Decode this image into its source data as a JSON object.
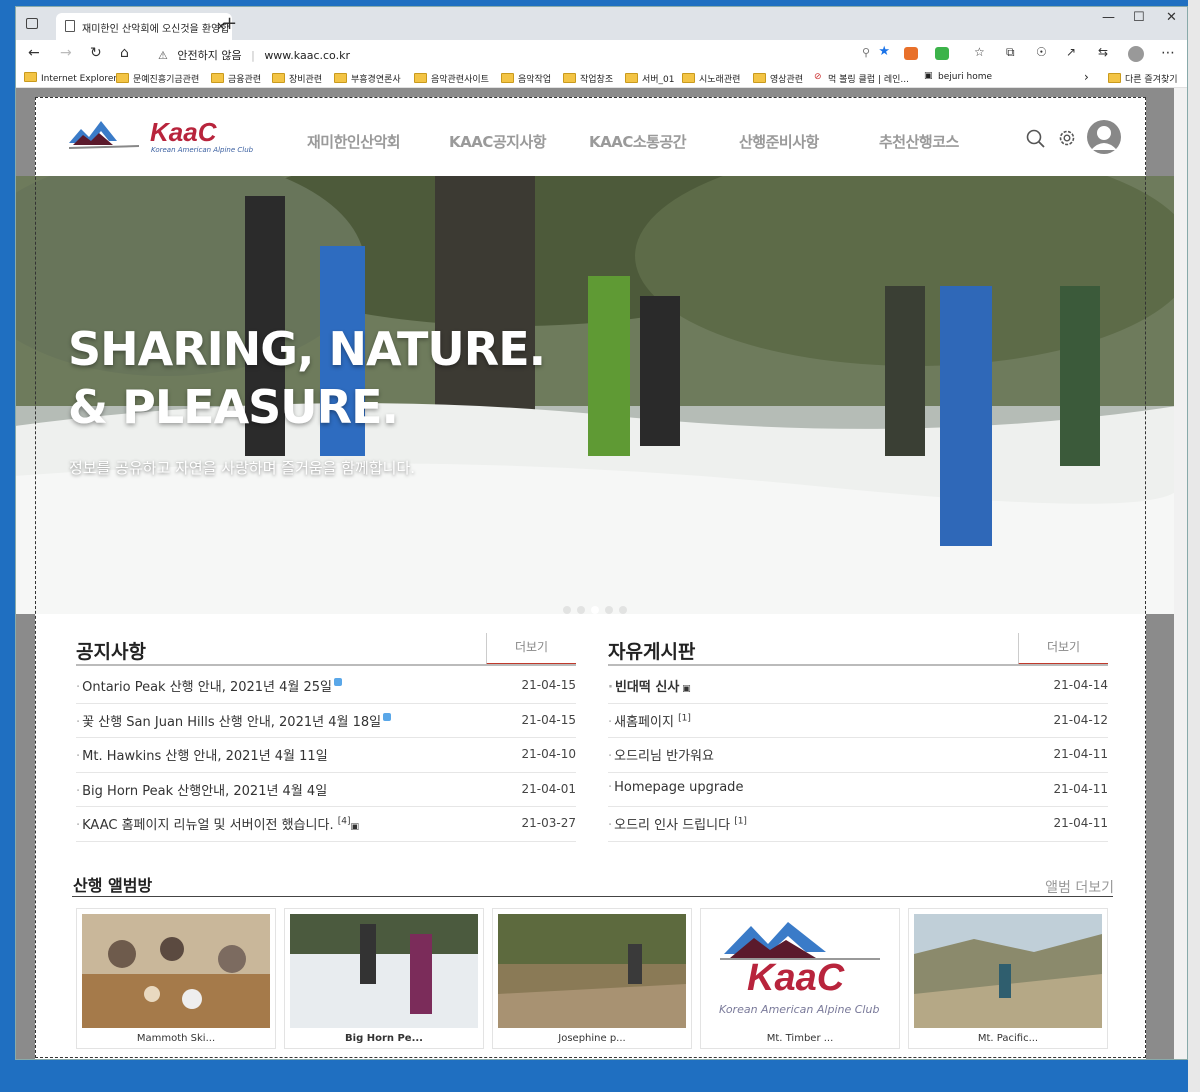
{
  "browser": {
    "tab_title": "재미한인 산악회에 오신것을 환영합",
    "tab_close": "×",
    "new_tab": "+",
    "security_warning": "안전하지 않음",
    "url": "www.kaac.co.kr",
    "favorites": [
      "Internet Explorer",
      "문예진흥기금관련",
      "금융관련",
      "장비관련",
      "부흥경연론사",
      "음악관련사이트",
      "음악작업",
      "작업창조",
      "서버_01",
      "시노래관련",
      "영상관련",
      "먹 볼링 클럽 | 레인...",
      "bejuri home",
      "다른 즐겨찾기"
    ]
  },
  "site": {
    "logo_text": "KaaC",
    "logo_sub": "Korean American Alpine Club",
    "nav": [
      "재미한인산악회",
      "KAAC공지사항",
      "KAAC소통공간",
      "산행준비사항",
      "추천산행코스"
    ]
  },
  "hero": {
    "line1": "SHARING, NATURE.",
    "line2": "& PLEASURE.",
    "subtitle": "정보를 공유하고 자연을 사랑하며 즐거움을 함께합니다."
  },
  "notice": {
    "title": "공지사항",
    "more": "더보기",
    "items": [
      {
        "title": "Ontario Peak 산행 안내, 2021년 4월 25일",
        "date": "21-04-15",
        "badge": "new",
        "extra": ""
      },
      {
        "title": "꽃 산행 San Juan Hills 산행 안내, 2021년 4월 18일",
        "date": "21-04-15",
        "badge": "new",
        "extra": ""
      },
      {
        "title": "Mt. Hawkins 산행 안내, 2021년 4월 11일",
        "date": "21-04-10",
        "badge": "",
        "extra": ""
      },
      {
        "title": "Big Horn Peak 산행안내, 2021년 4월 4일",
        "date": "21-04-01",
        "badge": "",
        "extra": ""
      },
      {
        "title": "KAAC 홈페이지 리뉴얼 및 서버이전 했습니다.",
        "date": "21-03-27",
        "badge": "img",
        "extra": "[4]"
      }
    ]
  },
  "free": {
    "title": "자유게시판",
    "more": "더보기",
    "items": [
      {
        "title": "빈대떡 신사",
        "date": "21-04-14",
        "badge": "img",
        "extra": ""
      },
      {
        "title": "새홈페이지",
        "date": "21-04-12",
        "badge": "",
        "extra": "[1]"
      },
      {
        "title": "오드리님 반가워요",
        "date": "21-04-11",
        "badge": "",
        "extra": ""
      },
      {
        "title": "Homepage upgrade",
        "date": "21-04-11",
        "badge": "",
        "extra": ""
      },
      {
        "title": "오드리 인사 드립니다",
        "date": "21-04-11",
        "badge": "",
        "extra": "[1]"
      }
    ]
  },
  "album": {
    "title": "산행 앨범방",
    "more": "앨범 더보기",
    "items": [
      "Mammoth Ski...",
      "Big Horn Pe...",
      "Josephine p...",
      "Mt. Timber ...",
      "Mt. Pacific..."
    ]
  },
  "colors": {
    "accent": "#c0392b",
    "logo_red": "#b8243c",
    "logo_blue": "#3a7bc8"
  }
}
